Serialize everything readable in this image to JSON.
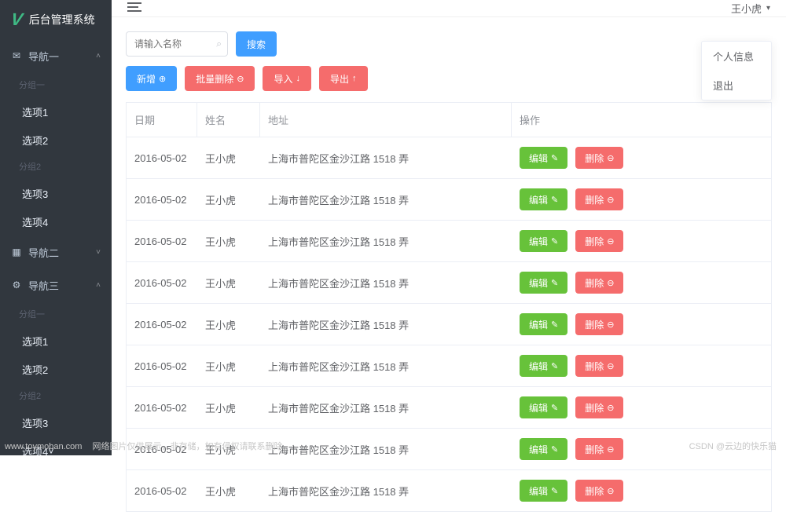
{
  "brand": {
    "logo_letter": "V",
    "title": "后台管理系统"
  },
  "sidebar": {
    "groups": [
      {
        "icon": "mail",
        "label": "导航一",
        "sections": [
          {
            "sub_label": "分组一",
            "items": [
              {
                "label": "选项1"
              },
              {
                "label": "选项2"
              }
            ]
          },
          {
            "sub_label": "分组2",
            "items": [
              {
                "label": "选项3"
              },
              {
                "label": "选项4"
              }
            ]
          }
        ]
      },
      {
        "icon": "grid",
        "label": "导航二",
        "sections": []
      },
      {
        "icon": "gear",
        "label": "导航三",
        "sections": [
          {
            "sub_label": "分组一",
            "items": [
              {
                "label": "选项1"
              },
              {
                "label": "选项2"
              }
            ]
          },
          {
            "sub_label": "分组2",
            "items": [
              {
                "label": "选项3"
              },
              {
                "label": "选项4"
              }
            ]
          }
        ]
      }
    ]
  },
  "topbar": {
    "username": "王小虎"
  },
  "dropdown": {
    "profile": "个人信息",
    "logout": "退出"
  },
  "toolbar": {
    "search_placeholder": "请输入名称",
    "search_btn": "搜索",
    "add_btn": "新增",
    "batch_delete_btn": "批量删除",
    "import_btn": "导入",
    "export_btn": "导出"
  },
  "table": {
    "headers": {
      "date": "日期",
      "name": "姓名",
      "address": "地址",
      "ops": "操作"
    },
    "edit_label": "编辑",
    "delete_label": "删除",
    "rows": [
      {
        "date": "2016-05-02",
        "name": "王小虎",
        "address": "上海市普陀区金沙江路 1518 弄"
      },
      {
        "date": "2016-05-02",
        "name": "王小虎",
        "address": "上海市普陀区金沙江路 1518 弄"
      },
      {
        "date": "2016-05-02",
        "name": "王小虎",
        "address": "上海市普陀区金沙江路 1518 弄"
      },
      {
        "date": "2016-05-02",
        "name": "王小虎",
        "address": "上海市普陀区金沙江路 1518 弄"
      },
      {
        "date": "2016-05-02",
        "name": "王小虎",
        "address": "上海市普陀区金沙江路 1518 弄"
      },
      {
        "date": "2016-05-02",
        "name": "王小虎",
        "address": "上海市普陀区金沙江路 1518 弄"
      },
      {
        "date": "2016-05-02",
        "name": "王小虎",
        "address": "上海市普陀区金沙江路 1518 弄"
      },
      {
        "date": "2016-05-02",
        "name": "王小虎",
        "address": "上海市普陀区金沙江路 1518 弄"
      },
      {
        "date": "2016-05-02",
        "name": "王小虎",
        "address": "上海市普陀区金沙江路 1518 弄"
      }
    ]
  },
  "footer": {
    "watermark": "www.toymoban.com",
    "note": "网络图片仅供展示，非存储，如有侵权请联系删除。",
    "right": "CSDN @云边的快乐猫"
  },
  "icons": {
    "mail": "✉",
    "grid": "▦",
    "gear": "⚙",
    "chevron_up": "˄",
    "chevron_down": "˅",
    "caret_down": "▾",
    "search": "⌕",
    "plus_circle": "⊕",
    "minus_circle": "⊖",
    "arrow_down": "↓",
    "arrow_up": "↑",
    "edit": "✎"
  }
}
